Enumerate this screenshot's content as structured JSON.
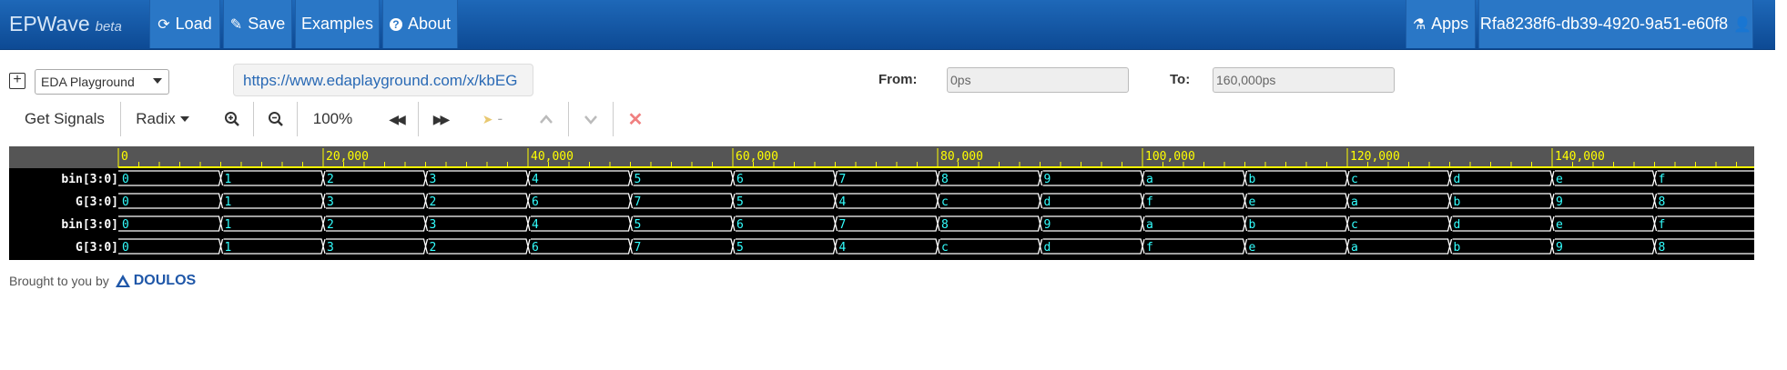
{
  "navbar": {
    "brand": "EPWave",
    "brand_sub": "beta",
    "load": "Load",
    "save": "Save",
    "examples": "Examples",
    "about": "About",
    "apps": "Apps",
    "user": "Rfa8238f6-db39-4920-9a51-e60f8"
  },
  "controls": {
    "source_select": "EDA Playground",
    "url": "https://www.edaplayground.com/x/kbEG",
    "from_label": "From:",
    "from_value": "0ps",
    "to_label": "To:",
    "to_value": "160,000ps"
  },
  "toolbar": {
    "get_signals": "Get Signals",
    "radix": "Radix",
    "zoom_level": "100%",
    "marker": "-"
  },
  "ruler": {
    "labels": [
      "0",
      "20,000",
      "40,000",
      "60,000",
      "80,000",
      "100,000",
      "120,000",
      "140,000"
    ]
  },
  "signals": [
    {
      "name": "bin[3:0]",
      "values": [
        "0",
        "1",
        "2",
        "3",
        "4",
        "5",
        "6",
        "7",
        "8",
        "9",
        "a",
        "b",
        "c",
        "d",
        "e",
        "f"
      ]
    },
    {
      "name": "G[3:0]",
      "values": [
        "0",
        "1",
        "3",
        "2",
        "6",
        "7",
        "5",
        "4",
        "c",
        "d",
        "f",
        "e",
        "a",
        "b",
        "9",
        "8"
      ]
    },
    {
      "name": "bin[3:0]",
      "values": [
        "0",
        "1",
        "2",
        "3",
        "4",
        "5",
        "6",
        "7",
        "8",
        "9",
        "a",
        "b",
        "c",
        "d",
        "e",
        "f"
      ]
    },
    {
      "name": "G[3:0]",
      "values": [
        "0",
        "1",
        "3",
        "2",
        "6",
        "7",
        "5",
        "4",
        "c",
        "d",
        "f",
        "e",
        "a",
        "b",
        "9",
        "8"
      ]
    }
  ],
  "footer": {
    "text": "Brought to you by",
    "logo": "DOULOS"
  },
  "colors": {
    "navbar": "#1e68b8",
    "ruler_text": "#ffff00",
    "wave_line": "#ffffff",
    "wave_value": "#33ffff"
  }
}
